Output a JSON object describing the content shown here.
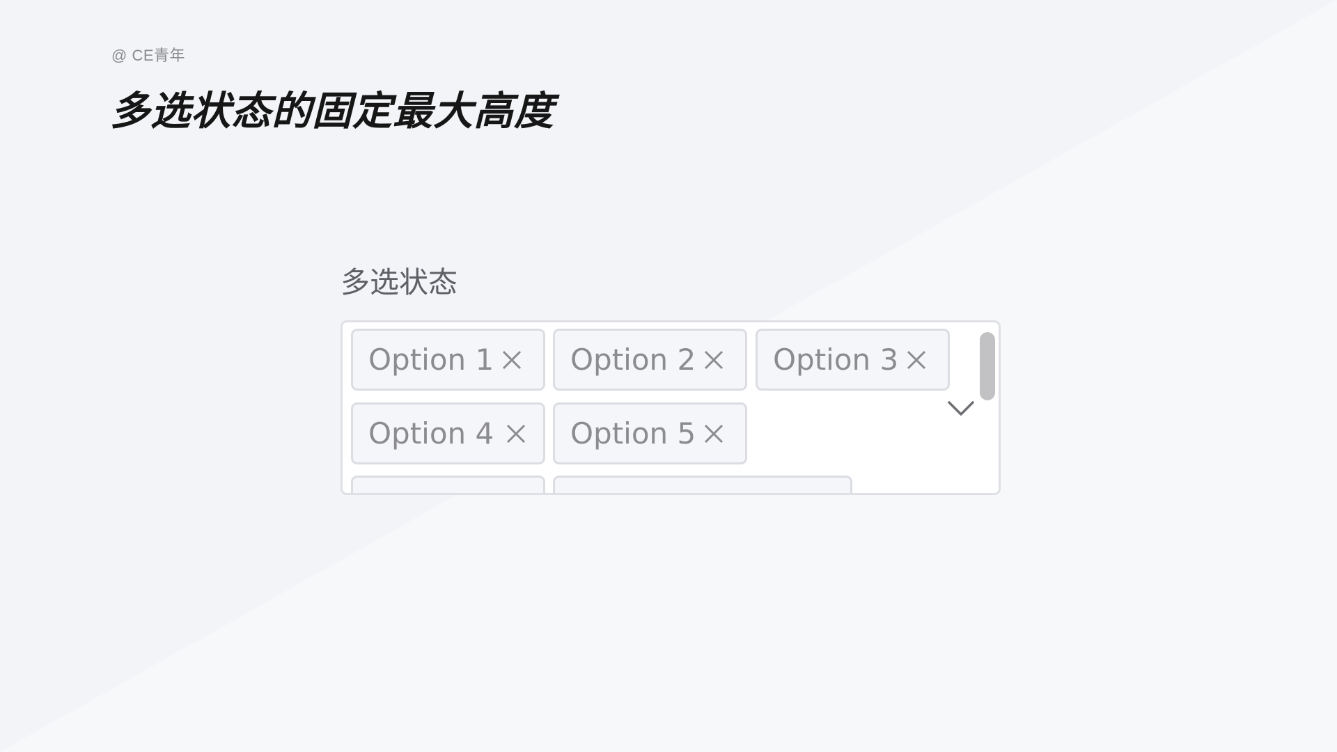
{
  "header": {
    "credit": "@ CE青年",
    "title": "多选状态的固定最大高度"
  },
  "select": {
    "label": "多选状态",
    "selected_tags": [
      {
        "label": "Option 1"
      },
      {
        "label": "Option 2"
      },
      {
        "label": "Option 3"
      },
      {
        "label": "Option 4"
      },
      {
        "label": "Option 5"
      },
      {
        "label": ""
      },
      {
        "label": ""
      }
    ],
    "remove_icon": "close-icon",
    "dropdown_icon": "chevron-down-icon",
    "scroll_position": 0
  },
  "colors": {
    "tag_background": "#f5f6fa",
    "tag_border": "#dcdde3",
    "tag_text": "#8c8c90",
    "scrollbar_thumb": "#c2c2c4",
    "title_text": "#161616"
  }
}
